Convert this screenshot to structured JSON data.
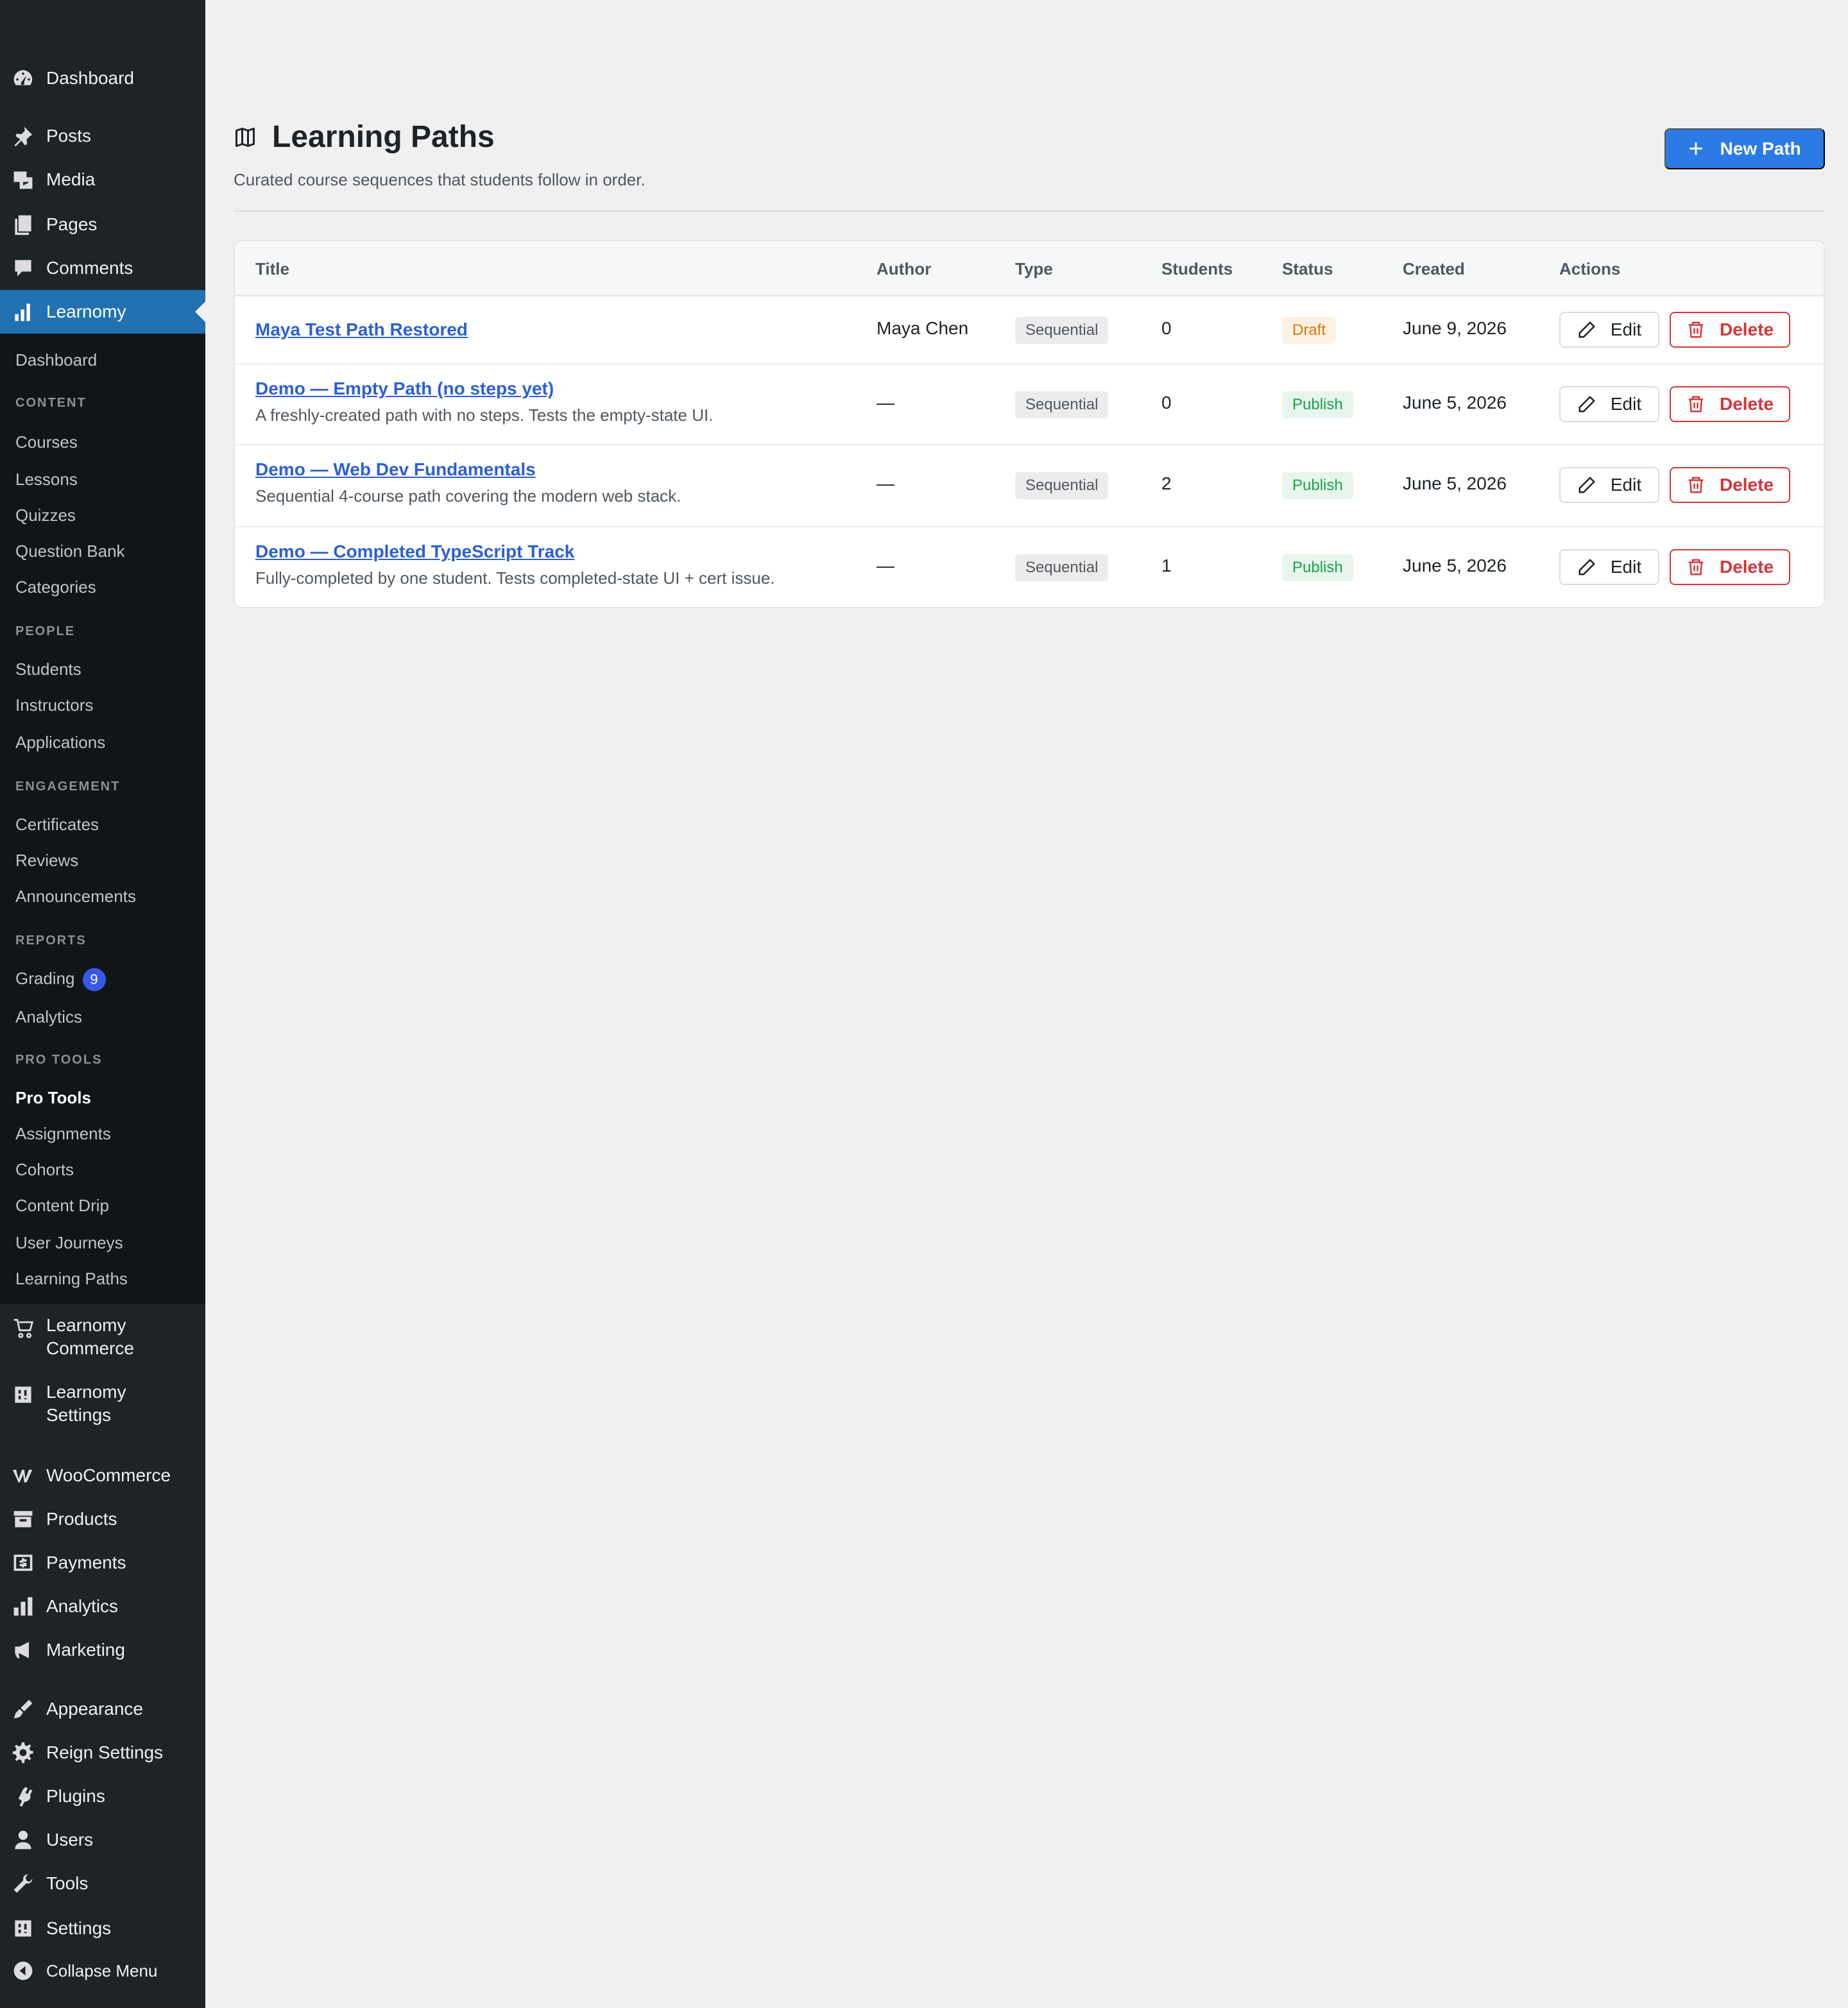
{
  "sidebar": {
    "top_items": [
      {
        "label": "Dashboard",
        "icon": "dashboard-icon"
      },
      {
        "label": "Posts",
        "icon": "pin-icon"
      },
      {
        "label": "Media",
        "icon": "media-icon"
      },
      {
        "label": "Pages",
        "icon": "pages-icon"
      },
      {
        "label": "Comments",
        "icon": "comment-icon"
      },
      {
        "label": "Learnomy",
        "icon": "chart-icon"
      }
    ],
    "submenu": {
      "dashboard": "Dashboard",
      "content_heading": "CONTENT",
      "courses": "Courses",
      "lessons": "Lessons",
      "quizzes": "Quizzes",
      "question_bank": "Question Bank",
      "categories": "Categories",
      "people_heading": "PEOPLE",
      "students": "Students",
      "instructors": "Instructors",
      "applications": "Applications",
      "engagement_heading": "ENGAGEMENT",
      "certificates": "Certificates",
      "reviews": "Reviews",
      "announcements": "Announcements",
      "reports_heading": "REPORTS",
      "grading": "Grading",
      "grading_count": "9",
      "analytics": "Analytics",
      "pro_tools_heading": "PRO TOOLS",
      "pro_tools": "Pro Tools",
      "assignments": "Assignments",
      "cohorts": "Cohorts",
      "content_drip": "Content Drip",
      "user_journeys": "User Journeys",
      "learning_paths": "Learning Paths"
    },
    "bottom_items": [
      {
        "label_1": "Learnomy",
        "label_2": "Commerce",
        "icon": "cart-icon"
      },
      {
        "label_1": "Learnomy",
        "label_2": "Settings",
        "icon": "settings-sliders-icon"
      }
    ],
    "lower_items": [
      {
        "label": "WooCommerce",
        "icon": "woo-icon"
      },
      {
        "label": "Products",
        "icon": "archive-icon"
      },
      {
        "label": "Payments",
        "icon": "dollar-icon"
      },
      {
        "label": "Analytics",
        "icon": "bar-chart-icon"
      },
      {
        "label": "Marketing",
        "icon": "megaphone-icon"
      },
      {
        "label": "Appearance",
        "icon": "brush-icon"
      },
      {
        "label": "Reign Settings",
        "icon": "gear-icon"
      },
      {
        "label": "Plugins",
        "icon": "plug-icon"
      },
      {
        "label": "Users",
        "icon": "user-icon"
      },
      {
        "label": "Tools",
        "icon": "wrench-icon"
      },
      {
        "label": "Settings",
        "icon": "sliders-icon"
      },
      {
        "label": "Collapse Menu",
        "icon": "collapse-icon"
      }
    ]
  },
  "header": {
    "title": "Learning Paths",
    "subtitle": "Curated course sequences that students follow in order.",
    "new_button": "New Path",
    "icon": "map-icon"
  },
  "table": {
    "columns": [
      "Title",
      "Author",
      "Type",
      "Students",
      "Status",
      "Created",
      "Actions"
    ],
    "rows": [
      {
        "title": "Maya Test Path Restored",
        "desc": "",
        "author": "Maya Chen",
        "type": "Sequential",
        "students": "0",
        "status": "Draft",
        "created": "June 9, 2026",
        "edit": "Edit",
        "delete": "Delete"
      },
      {
        "title": "Demo — Empty Path (no steps yet)",
        "desc": "A freshly-created path with no steps. Tests the empty-state UI.",
        "author": "—",
        "type": "Sequential",
        "students": "0",
        "status": "Publish",
        "created": "June 5, 2026",
        "edit": "Edit",
        "delete": "Delete"
      },
      {
        "title": "Demo — Web Dev Fundamentals",
        "desc": "Sequential 4-course path covering the modern web stack.",
        "author": "—",
        "type": "Sequential",
        "students": "2",
        "status": "Publish",
        "created": "June 5, 2026",
        "edit": "Edit",
        "delete": "Delete"
      },
      {
        "title": "Demo — Completed TypeScript Track",
        "desc": "Fully-completed by one student. Tests completed-state UI + cert issue.",
        "author": "—",
        "type": "Sequential",
        "students": "1",
        "status": "Publish",
        "created": "June 5, 2026",
        "edit": "Edit",
        "delete": "Delete"
      }
    ]
  },
  "colors": {
    "sidebar_bg": "#1d2327",
    "submenu_bg": "#101517",
    "active_bg": "#2271b1",
    "primary_button": "#2c7be5",
    "link": "#2c5fd6",
    "danger": "#d63638",
    "draft": "#d97706",
    "publish": "#16a34a"
  }
}
